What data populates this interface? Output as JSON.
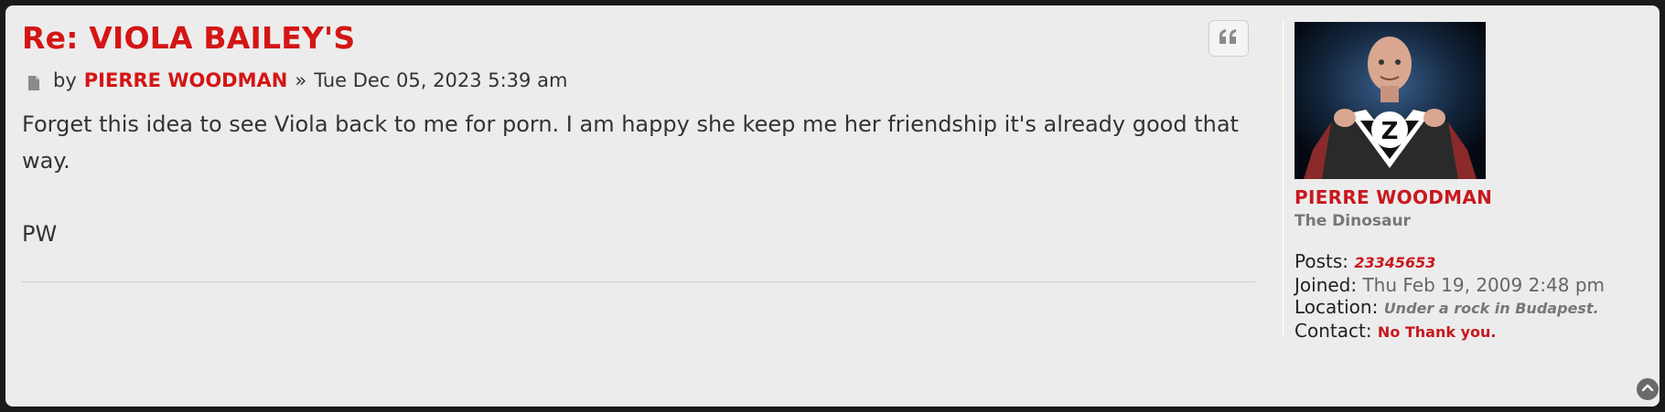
{
  "post": {
    "title": "Re: VIOLA BAILEY'S",
    "by_label": "by",
    "author": "PIERRE WOODMAN",
    "separator": "»",
    "date": "Tue Dec 05, 2023 5:39 am",
    "content": [
      "Forget this idea to see Viola back to me for porn. I am happy she keep me her friendship it's already good that way.",
      "PW"
    ]
  },
  "profile": {
    "name": "PIERRE WOODMAN",
    "rank": "The Dinosaur",
    "avatar_letter": "Z",
    "posts_label": "Posts:",
    "posts_value": "23345653",
    "joined_label": "Joined:",
    "joined_value": "Thu Feb 19, 2009 2:48 pm",
    "location_label": "Location:",
    "location_value": "Under a rock in Budapest.",
    "contact_label": "Contact:",
    "contact_value": "No Thank you."
  },
  "icons": {
    "post": "file-icon",
    "quote": "quote-icon",
    "top": "chevron-up-icon"
  },
  "colors": {
    "accent": "#d41515",
    "background": "#ececec",
    "frame": "#1a1a1a"
  }
}
